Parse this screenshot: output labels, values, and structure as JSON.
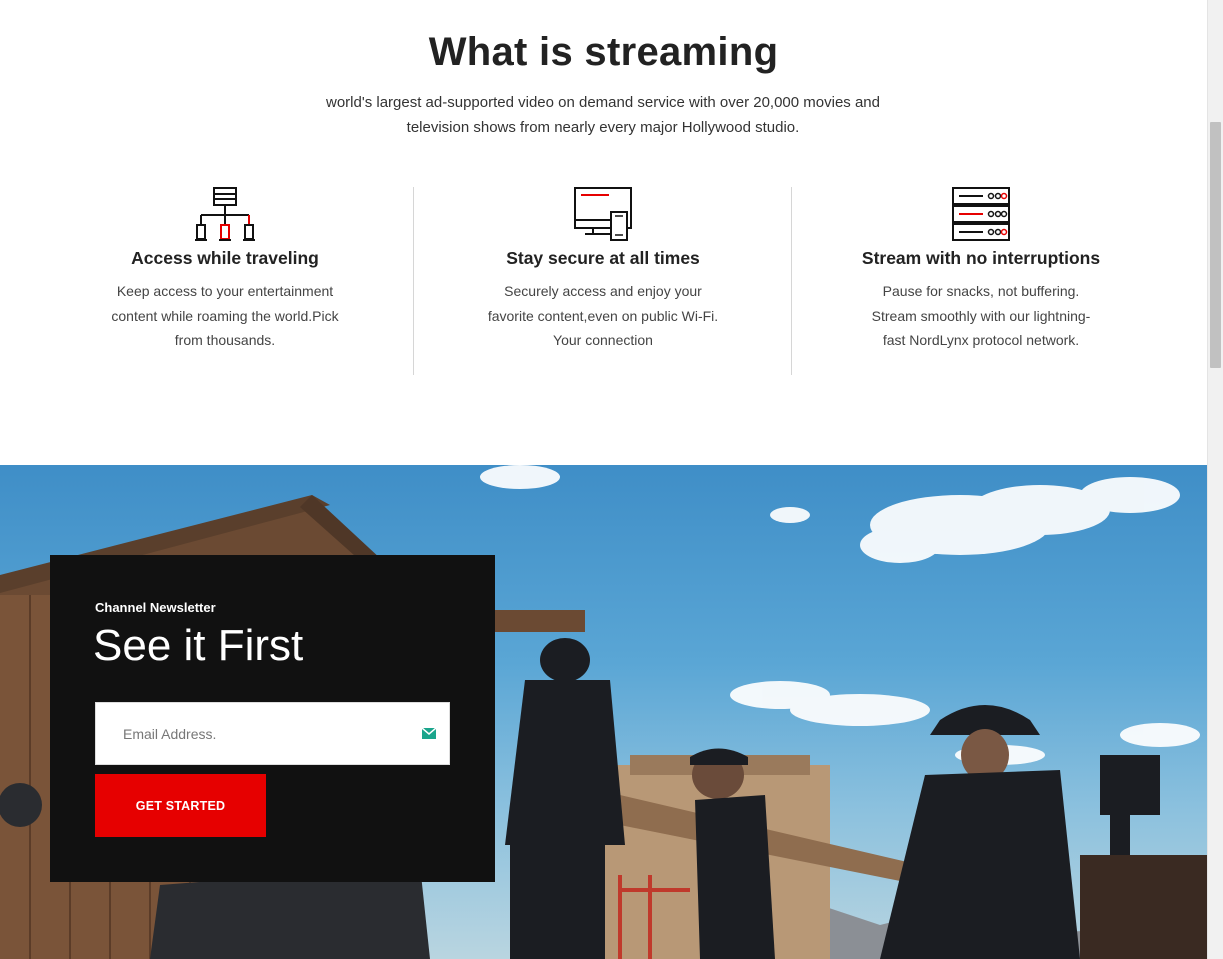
{
  "intro": {
    "title": "What is streaming",
    "subtitle": "world's largest ad-supported video on demand service with over 20,000 movies and television shows from nearly every major Hollywood studio."
  },
  "features": [
    {
      "icon": "network-devices-icon",
      "title": "Access while traveling",
      "text": "Keep access to your entertainment content while roaming the world.Pick from thousands."
    },
    {
      "icon": "monitor-mobile-icon",
      "title": "Stay secure at all times",
      "text": "Securely access and enjoy your favorite content,even on public Wi-Fi. Your connection"
    },
    {
      "icon": "server-rack-icon",
      "title": "Stream with no interruptions",
      "text": "Pause for snacks, not buffering. Stream smoothly with our lightning-fast NordLynx protocol network."
    }
  ],
  "newsletter": {
    "label": "Channel Newsletter",
    "heading": "See it First",
    "email_placeholder": "Email Address.",
    "cta_label": "GET STARTED"
  },
  "colors": {
    "accent": "#e60000",
    "panel": "#111111",
    "text_dark": "#222222",
    "mail_icon": "#1aa58c"
  }
}
